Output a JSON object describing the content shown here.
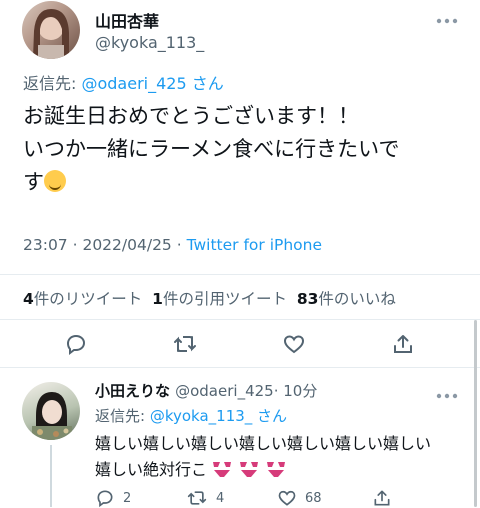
{
  "tweet": {
    "author_name": "山田杏華",
    "author_handle": "@kyoka_113_",
    "reply_prefix": "返信先: ",
    "reply_to": "@odaeri_425",
    "reply_suffix": " さん",
    "text_line1": "お誕生日おめでとうございます！！",
    "text_line2": "いつか一緒にラーメン食べに行きたいで",
    "text_line3": "す",
    "time": "23:07",
    "date": "2022/04/25",
    "separator": " · ",
    "source": "Twitter for iPhone",
    "retweets_count": "4",
    "retweets_label": "件のリツイート",
    "quotes_count": "1",
    "quotes_label": "件の引用ツイート",
    "likes_count": "83",
    "likes_label": "件のいいね"
  },
  "reply": {
    "author_name": "小田えりな",
    "author_handle": "@odaeri_425",
    "time_ago": "· 10分",
    "reply_prefix": "返信先: ",
    "reply_to": "@kyoka_113_",
    "reply_suffix": " さん",
    "text_line1": "嬉しい嬉しい嬉しい嬉しい嬉しい嬉しい嬉しい",
    "text_line2": "嬉しい絶対行こ",
    "reply_count": "2",
    "retweet_count": "4",
    "like_count": "68"
  },
  "colors": {
    "link": "#1d9bf0",
    "muted": "#536471",
    "text": "#0f1419",
    "divider": "#e6ecf0"
  },
  "icons": [
    "more-icon",
    "reply-icon",
    "retweet-icon",
    "like-icon",
    "share-icon",
    "smiling-face-hearts-icon",
    "bikini-icon"
  ]
}
